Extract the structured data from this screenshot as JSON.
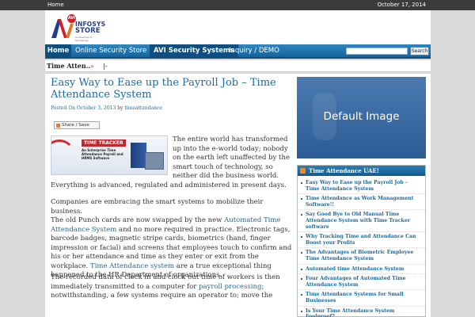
{
  "topbar": {
    "home": "Home",
    "date": "October 17, 2014"
  },
  "logo": {
    "badge": "AVI",
    "line1": "INFOSYS",
    "line2": "STORE",
    "tagline": "Accessories of Technology"
  },
  "nav": {
    "items": [
      "Home",
      "Online Security Store",
      "AVI Security Systems",
      "Inquiry / DEMO"
    ],
    "search_button": "Search",
    "search_value": ""
  },
  "ticker": {
    "label": "Time Atten..",
    "arrow": "»",
    "sep": "|-"
  },
  "post": {
    "title": "Easy Way to Ease up the Payroll Job – Time Attendance System",
    "byline_prefix": "Posted On",
    "date": "October 3, 2013",
    "by": "by",
    "author": "timeattendance",
    "share": "Share / Save",
    "product": {
      "logo": "TIME TRACKER",
      "desc": "An Enterprise Time Attendance Payroll and HRMS Software"
    },
    "p1_wrap": [
      "The entire world has transformed",
      "up into the e-world today; nobody",
      "on the earth left unaffected by the",
      "smart touch of technology, so",
      "neither did the business world."
    ],
    "p1_full": "Everything is advanced, regulated and administered in present days.",
    "p2a": "Companies are embracing the smart systems to mobilize their business.",
    "p2b_pre": "The old Punch cards are now swapped by the new ",
    "p2b_link": "Automated Time",
    "p2c_link": "Attendance System",
    "p2c_post": " and no more required in practice. Electronic tags,",
    "p2d": "barcode badges, magnetic stripe cards, biometrics (hand, finger",
    "p2e": "impression or facial) and screens that employees touch to confirm and",
    "p2f": "his or her attendance and time as they enter or exit from the",
    "p2g_pre": "workplace. ",
    "p2g_link": "Time Attendance system",
    "p2g_post": " are a true exceptional thing",
    "p2h": "happened to the HR Department of organizations.",
    "p3a": "The recorded data of clock in and clock out time of workers is then",
    "p3b_pre": "immediately transmitted to a computer for ",
    "p3b_link": "payroll processing",
    "p3b_post": ";",
    "p3c": "notwithstanding, a few systems require an operator to; move the"
  },
  "sidebar": {
    "image_caption": "Default Image",
    "widget_title": "Time Attendance UAE!",
    "links": [
      "Easy Way to Ease up the Payroll Job – Time Attendance System",
      "Time Attendance as Work Management Software!!",
      "Say Good Bye to Old Manual Time Attendance System with Time Tracker software",
      "Why Tracking Time and Attendance Can Boost your Profits",
      "The Advantages of Biometric Employee Time Attendance System",
      "Automated time Attendance System",
      "Four Advantages of Automated Time Attendance System",
      "Time Attendance Systems for Small Businesses",
      "Is Your Time Attendance System Foolproof?"
    ]
  },
  "colors": {
    "link": "#1a6ba0",
    "nav": "#17639b",
    "topbar": "#3b3b3b"
  }
}
